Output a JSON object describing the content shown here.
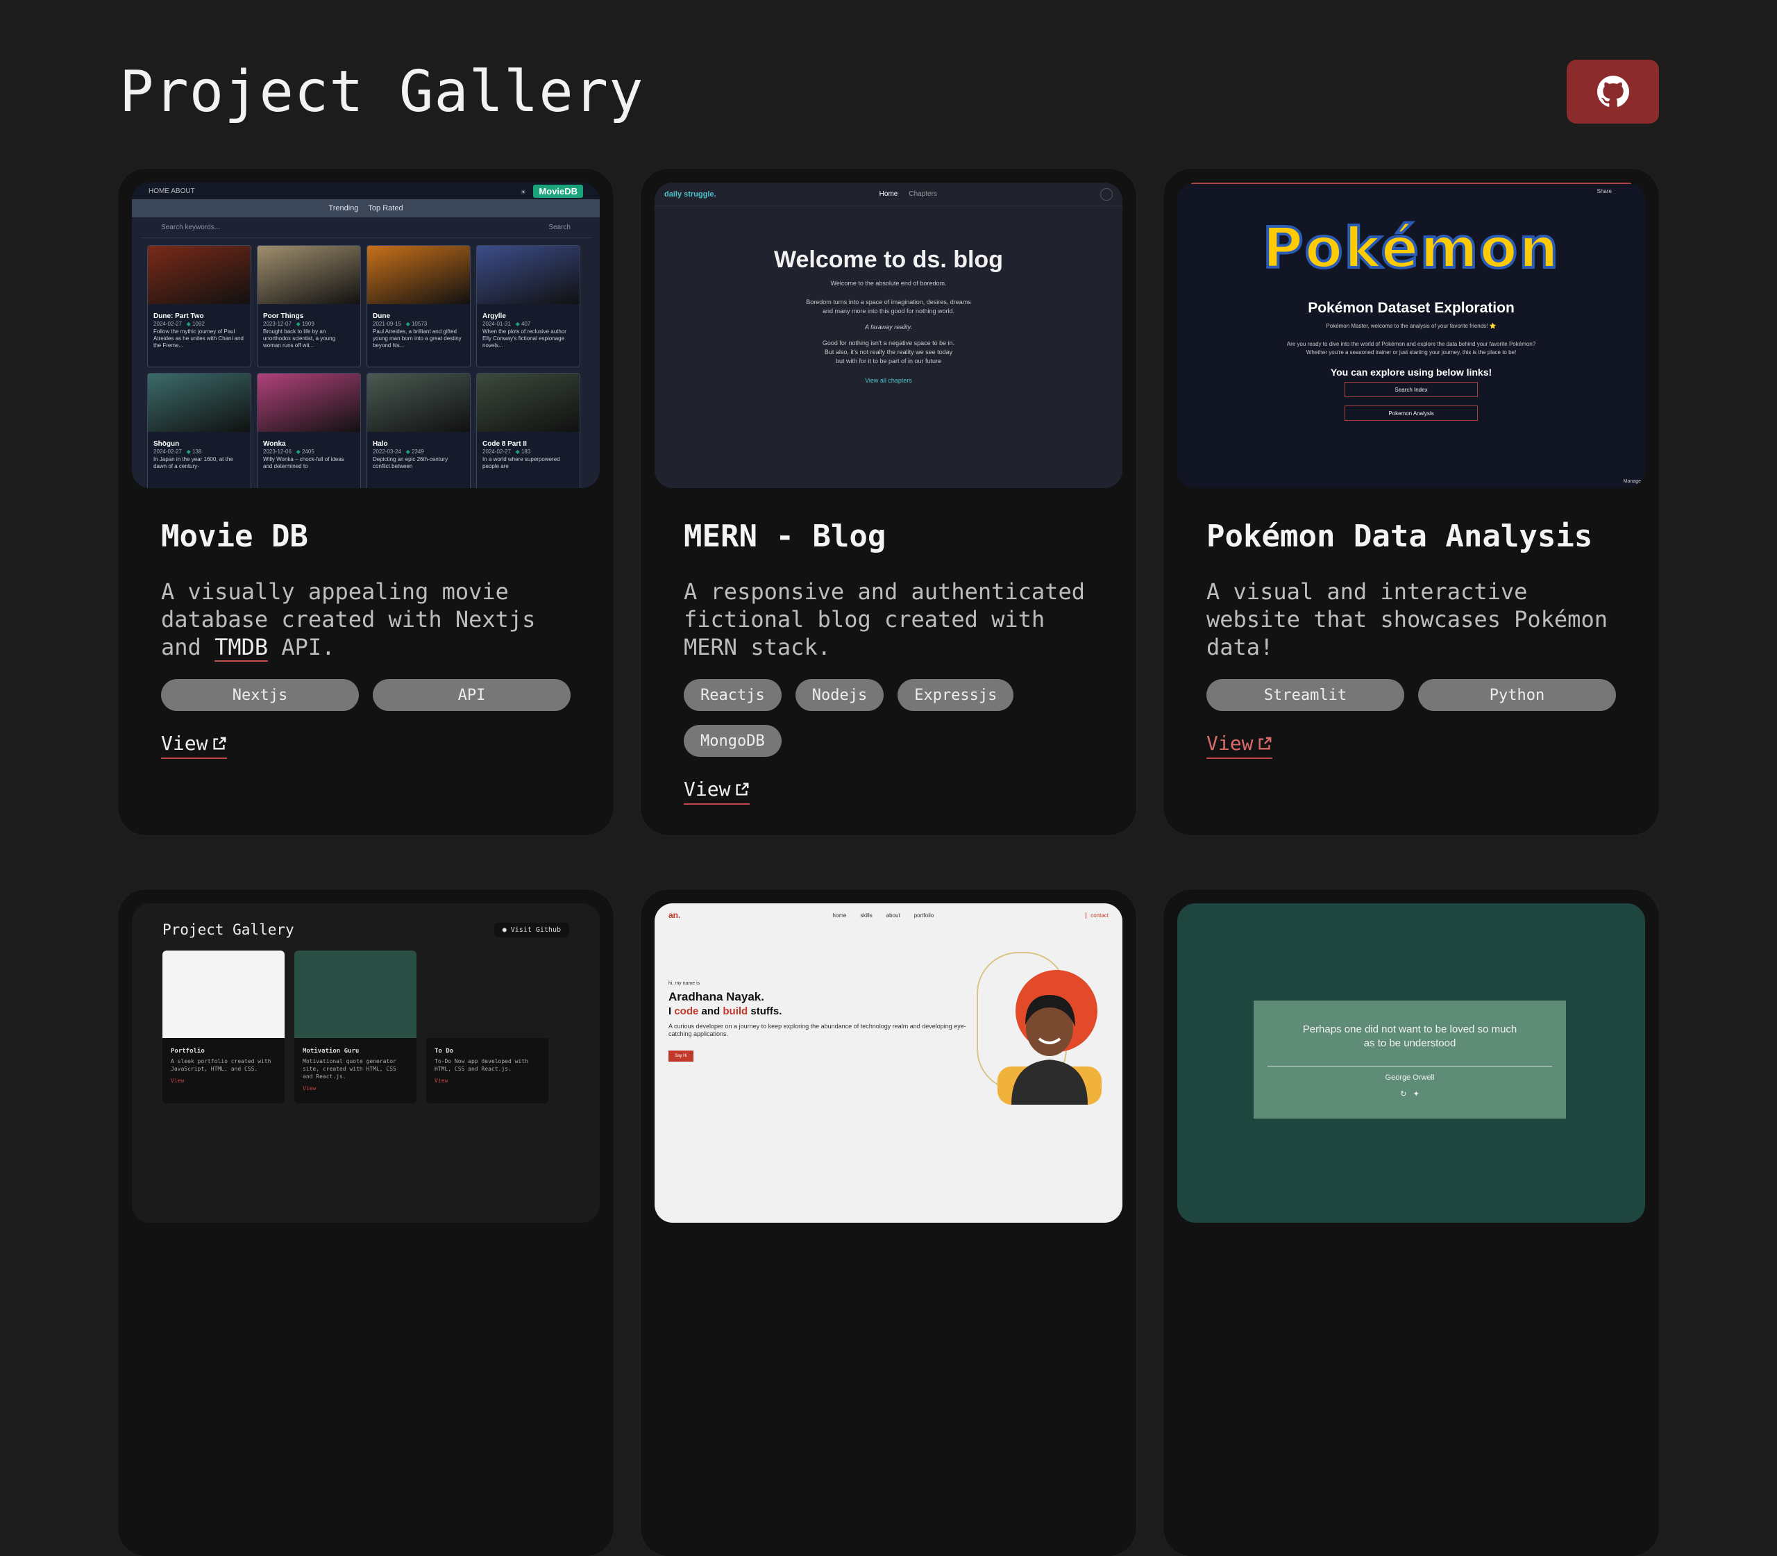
{
  "header": {
    "title": "Project Gallery",
    "github_icon": "github-icon"
  },
  "projects": [
    {
      "title": "Movie DB",
      "desc_before": "A visually appealing movie database created with Nextjs and ",
      "desc_link": "TMDB",
      "desc_after": " API.",
      "tags": [
        "Nextjs",
        "API"
      ],
      "view": "View",
      "preview": {
        "nav_left": "HOME  ABOUT",
        "logo": "MovieDB",
        "tabs": [
          "Trending",
          "Top Rated"
        ],
        "search_placeholder": "Search keywords...",
        "search_button": "Search",
        "movies": [
          {
            "title": "Dune: Part Two",
            "date": "2024-02-27",
            "votes": "1092",
            "desc": "Follow the mythic journey of Paul Atreides as he unites with Chani and the Freme...",
            "color": "#7a2a18"
          },
          {
            "title": "Poor Things",
            "date": "2023-12-07",
            "votes": "1909",
            "desc": "Brought back to life by an unorthodox scientist, a young woman runs off wit...",
            "color": "#a08f6e"
          },
          {
            "title": "Dune",
            "date": "2021-09-15",
            "votes": "10573",
            "desc": "Paul Atreides, a brilliant and gifted young man born into a great destiny beyond his...",
            "color": "#c7701a"
          },
          {
            "title": "Argylle",
            "date": "2024-01-31",
            "votes": "407",
            "desc": "When the plots of reclusive author Elly Conway's fictional espionage novels...",
            "color": "#3c4d8a"
          },
          {
            "title": "Shōgun",
            "date": "2024-02-27",
            "votes": "138",
            "desc": "In Japan in the year 1600, at the dawn of a century-",
            "color": "#3b6b6a"
          },
          {
            "title": "Wonka",
            "date": "2023-12-06",
            "votes": "2405",
            "desc": "Willy Wonka – chock-full of ideas and determined to",
            "color": "#b0427a"
          },
          {
            "title": "Halo",
            "date": "2022-03-24",
            "votes": "2349",
            "desc": "Depicting an epic 26th-century conflict between",
            "color": "#4a5a52"
          },
          {
            "title": "Code 8 Part II",
            "date": "2024-02-27",
            "votes": "183",
            "desc": "In a world where superpowered people are",
            "color": "#3c4a3c"
          }
        ]
      }
    },
    {
      "title": "MERN - Blog",
      "desc": "A responsive and authenticated fictional blog created with MERN stack.",
      "tags": [
        "Reactjs",
        "Nodejs",
        "Expressjs",
        "MongoDB"
      ],
      "view": "View",
      "preview": {
        "brand": "daily struggle.",
        "nav": [
          "Home",
          "Chapters"
        ],
        "heading": "Welcome to ds. blog",
        "p1": "Welcome to the absolute end of boredom.",
        "p2a": "Boredom turns into a space of imagination, desires, dreams",
        "p2b": "and many more into this good for nothing world.",
        "p3": "A faraway reality.",
        "p4a": "Good for nothing isn't a negative space to be in.",
        "p4b": "But also, it's not really the reality we see today",
        "p4c": "but with for it to be part of in our future",
        "link": "View all chapters"
      }
    },
    {
      "title": "Pokémon Data Analysis",
      "desc": "A visual and interactive website that showcases Pokémon data!",
      "tags": [
        "Streamlit",
        "Python"
      ],
      "view": "View",
      "preview": {
        "share": "Share",
        "logo": "Pokémon",
        "heading": "Pokémon Dataset Exploration",
        "sub": "Pokémon Master, welcome to the analysis of your favorite friends! ⭐",
        "sub2a": "Are you ready to dive into the world of Pokémon and explore the data behind your favorite Pokémon?",
        "sub2b": "Whether you're a seasoned trainer or just starting your journey, this is the place to be!",
        "heading2": "You can explore using below links!",
        "btn1": "Search Index",
        "btn2": "Pokemon Analysis",
        "manage": "Manage"
      }
    },
    {
      "preview": {
        "title": "Project Gallery",
        "button": "Visit Github",
        "cards": [
          {
            "title": "Portfolio",
            "desc": "A sleek portfolio created with JavaScript, HTML, and CSS.",
            "view": "View",
            "color": "#f4f4f4"
          },
          {
            "title": "Motivation Guru",
            "desc": "Motivational quote generator site, created with HTML, CSS and React.js.",
            "view": "View",
            "color": "#2a5046"
          },
          {
            "title": "To Do",
            "desc": "To-Do Now app developed with HTML, CSS and React.js.",
            "view": "View",
            "color": "#1b1b1b"
          }
        ]
      }
    },
    {
      "preview": {
        "logo": "an.",
        "nav": [
          "home",
          "skills",
          "about",
          "portfolio"
        ],
        "contact": "contact",
        "greet": "hi, my name is",
        "name": "Aradhana Nayak.",
        "sub_a": "I ",
        "sub_code": "code",
        "sub_b": " and ",
        "sub_build": "build",
        "sub_c": " stuffs.",
        "desc": "A curious developer on a journey to keep exploring the abundance of technology realm and developing eye-catching applications.",
        "btn": "Say Hi"
      }
    },
    {
      "preview": {
        "quote_a": "Perhaps one did not want to be loved so much",
        "quote_b": "as to be understood",
        "author": "George Orwell"
      }
    }
  ]
}
